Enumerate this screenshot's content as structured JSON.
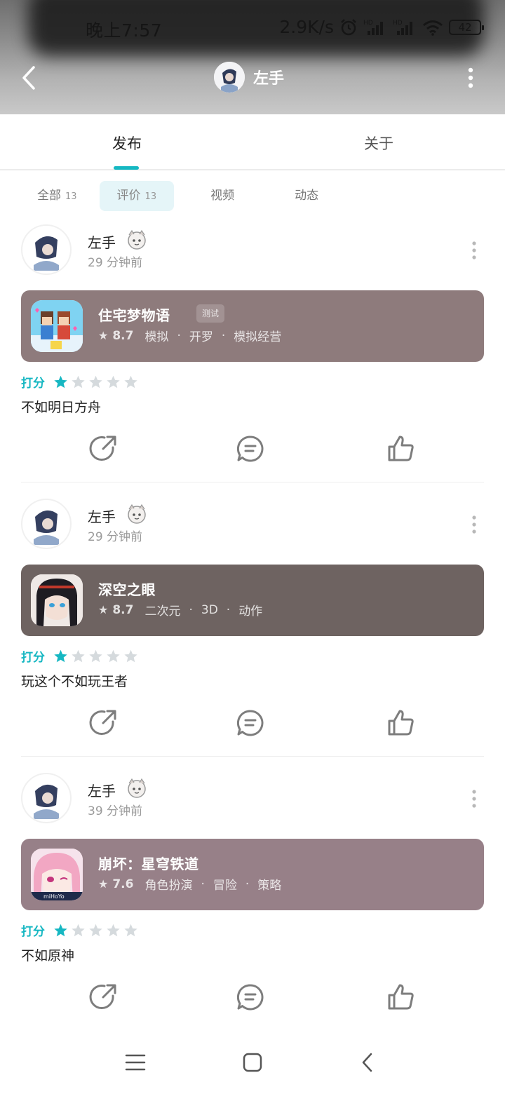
{
  "status_bar": {
    "time": "晚上7:57",
    "network_speed": "2.9K/s",
    "battery": "42",
    "icons": [
      "alarm-icon",
      "signal-hd-icon",
      "signal-hd-icon",
      "wifi-icon",
      "battery-icon"
    ]
  },
  "header": {
    "title": "左手",
    "icons": [
      "back-arrow-icon",
      "avatar",
      "more-vertical-icon"
    ]
  },
  "main_tabs": [
    {
      "label": "发布",
      "active": true
    },
    {
      "label": "关于",
      "active": false
    }
  ],
  "sub_tabs": [
    {
      "label": "全部",
      "count": "13",
      "active": false
    },
    {
      "label": "评价",
      "count": "13",
      "active": true
    },
    {
      "label": "视频",
      "count": "",
      "active": false
    },
    {
      "label": "动态",
      "count": "",
      "active": false
    }
  ],
  "reviews": [
    {
      "username": "左手",
      "time": "29 分钟前",
      "game": {
        "name": "住宅梦物语",
        "tag": "测试",
        "score": "8.7",
        "tags": [
          "模拟",
          "开罗",
          "模拟经营"
        ],
        "card_color": "#8e7b7c"
      },
      "rating_label": "打分",
      "stars": 1,
      "text": "不如明日方舟"
    },
    {
      "username": "左手",
      "time": "29 分钟前",
      "game": {
        "name": "深空之眼",
        "tag": "",
        "score": "8.7",
        "tags": [
          "二次元",
          "3D",
          "动作"
        ],
        "card_color": "#6e6361"
      },
      "rating_label": "打分",
      "stars": 1,
      "text": "玩这个不如玩王者"
    },
    {
      "username": "左手",
      "time": "39 分钟前",
      "game": {
        "name": "崩坏：星穹铁道",
        "tag": "",
        "score": "7.6",
        "tags": [
          "角色扮演",
          "冒险",
          "策略"
        ],
        "card_color": "#978088"
      },
      "rating_label": "打分",
      "stars": 1,
      "text": "不如原神"
    }
  ],
  "colors": {
    "accent": "#15b8c2",
    "star_empty": "#d5dadd"
  },
  "system_nav": [
    "menu-icon",
    "home-square-icon",
    "back-chevron-icon"
  ]
}
